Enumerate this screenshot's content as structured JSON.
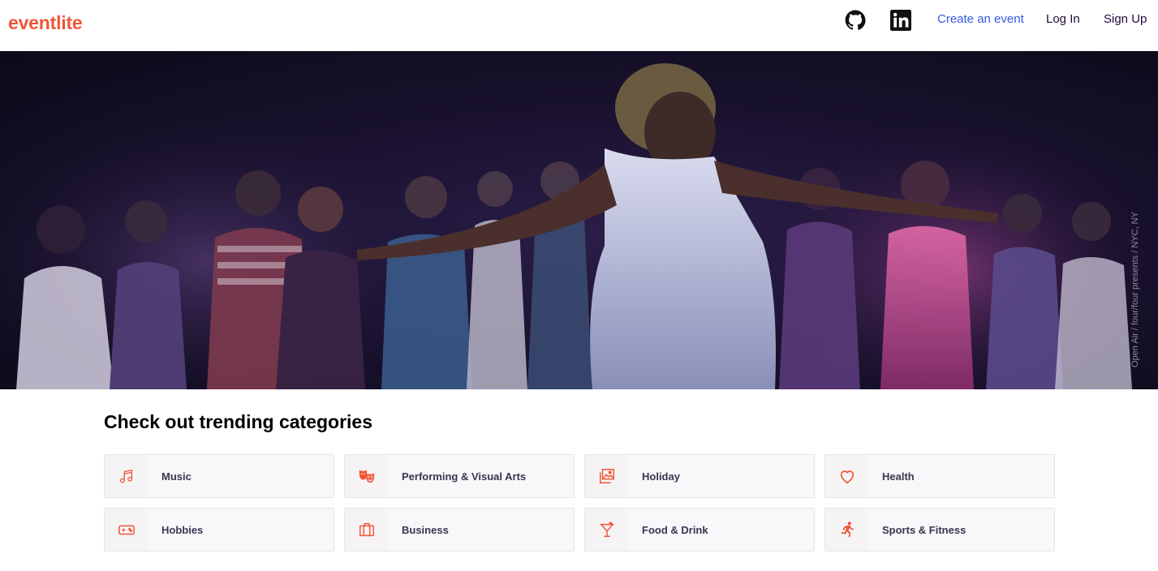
{
  "brand": {
    "name": "eventlite",
    "accent": "#f05537",
    "link_blue": "#3659e3"
  },
  "header": {
    "icons": [
      {
        "name": "github-icon"
      },
      {
        "name": "linkedin-icon"
      }
    ],
    "create_label": "Create an event",
    "login_label": "Log In",
    "signup_label": "Sign Up"
  },
  "hero": {
    "credit": "Open Air / four/four presents / NYC, NY"
  },
  "categories": {
    "title": "Check out trending categories",
    "items": [
      {
        "label": "Music",
        "icon": "music-note-icon"
      },
      {
        "label": "Performing & Visual Arts",
        "icon": "theater-masks-icon"
      },
      {
        "label": "Holiday",
        "icon": "image-gallery-icon"
      },
      {
        "label": "Health",
        "icon": "heart-icon"
      },
      {
        "label": "Hobbies",
        "icon": "gamepad-icon"
      },
      {
        "label": "Business",
        "icon": "briefcase-icon"
      },
      {
        "label": "Food & Drink",
        "icon": "cocktail-icon"
      },
      {
        "label": "Sports & Fitness",
        "icon": "running-person-icon"
      }
    ]
  }
}
